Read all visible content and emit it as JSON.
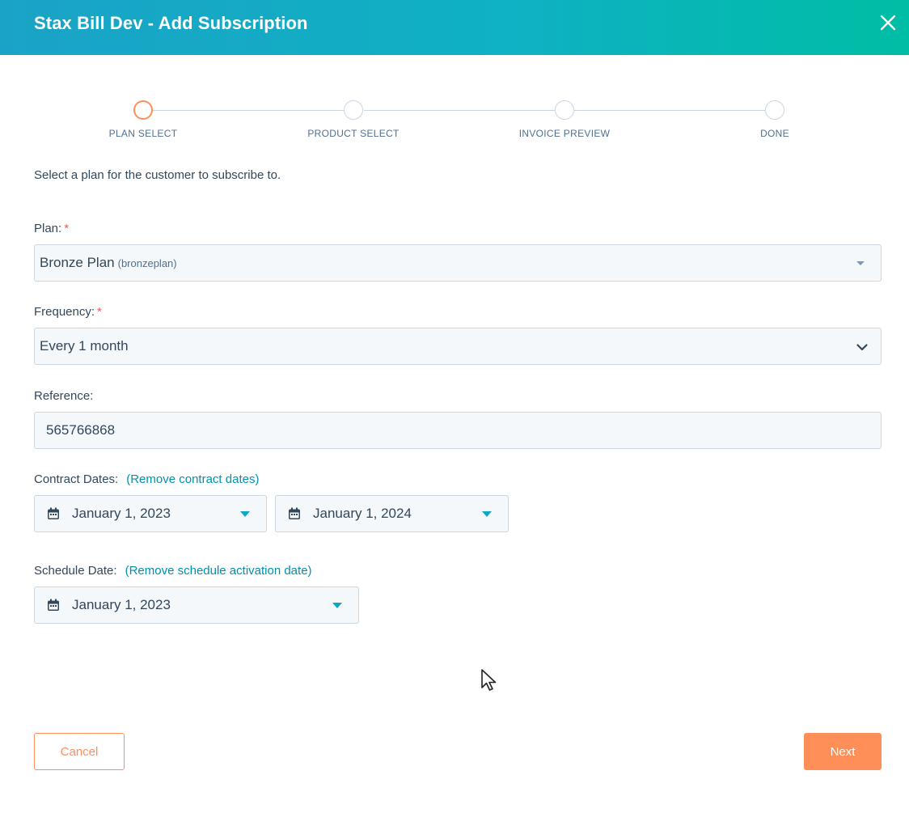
{
  "header": {
    "title": "Stax Bill Dev - Add Subscription"
  },
  "stepper": {
    "steps": [
      {
        "label": "PLAN SELECT"
      },
      {
        "label": "PRODUCT SELECT"
      },
      {
        "label": "INVOICE PREVIEW"
      },
      {
        "label": "DONE"
      }
    ],
    "active_color": "#ff8f59"
  },
  "intro": "Select a plan for the customer to subscribe to.",
  "plan": {
    "label": "Plan:",
    "required": "*",
    "value": "Bronze Plan",
    "code": "(bronzeplan)"
  },
  "frequency": {
    "label": "Frequency:",
    "required": "*",
    "value": "Every 1 month"
  },
  "reference": {
    "label": "Reference:",
    "value": "565766868"
  },
  "contract_dates": {
    "label": "Contract Dates:",
    "link": "(Remove contract dates)",
    "start": "January 1, 2023",
    "end": "January 1, 2024"
  },
  "schedule_date": {
    "label": "Schedule Date:",
    "link": "(Remove schedule activation date)",
    "value": "January 1, 2023"
  },
  "buttons": {
    "cancel": "Cancel",
    "next": "Next"
  },
  "colors": {
    "accent": "#ff8f59",
    "link": "#0091ae",
    "header_start": "#1aa3c6",
    "header_end": "#00bda5"
  },
  "icons": {
    "close": "close-icon",
    "calendar": "calendar-icon",
    "dropdown": "caret-down-icon",
    "chevron": "chevron-down-icon"
  }
}
